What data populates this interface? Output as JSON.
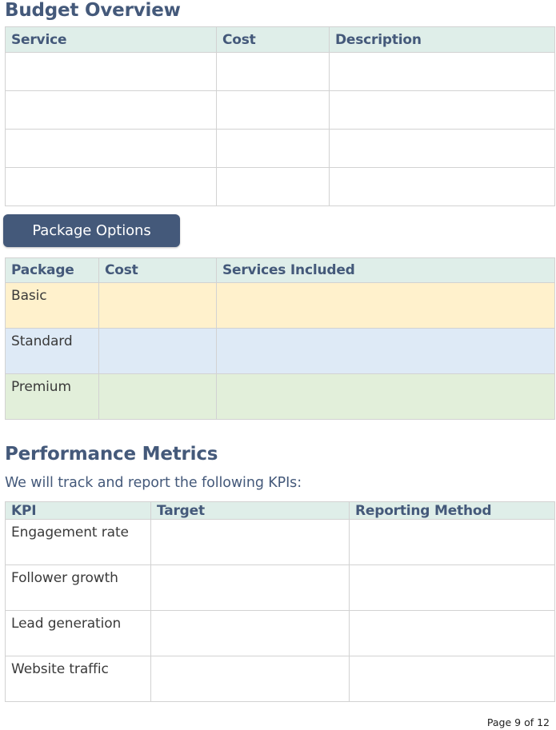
{
  "budget_overview": {
    "title": "Budget Overview",
    "columns": [
      "Service",
      "Cost",
      "Description"
    ],
    "rows": [
      [
        "",
        "",
        ""
      ],
      [
        "",
        "",
        ""
      ],
      [
        "",
        "",
        ""
      ],
      [
        "",
        "",
        ""
      ]
    ]
  },
  "package_options": {
    "button_label": "Package Options",
    "button_color": "#44597a",
    "columns": [
      "Package",
      "Cost",
      "Services Included"
    ],
    "rows": [
      {
        "name": "Basic",
        "cost": "",
        "services": "",
        "color": "#fff1cc"
      },
      {
        "name": "Standard",
        "cost": "",
        "services": "",
        "color": "#deeaf6"
      },
      {
        "name": "Premium",
        "cost": "",
        "services": "",
        "color": "#e2efda"
      }
    ]
  },
  "performance_metrics": {
    "title": "Performance Metrics",
    "intro": "We will track and report the following KPIs:",
    "columns": [
      "KPI",
      "Target",
      "Reporting Method"
    ],
    "rows": [
      {
        "kpi": "Engagement rate",
        "target": "",
        "method": ""
      },
      {
        "kpi": "Follower growth",
        "target": "",
        "method": ""
      },
      {
        "kpi": "Lead generation",
        "target": "",
        "method": ""
      },
      {
        "kpi": "Website traffic",
        "target": "",
        "method": ""
      }
    ]
  },
  "colors": {
    "heading": "#44597a",
    "header_fill": "#dfeee9",
    "border": "#d2d2d2"
  },
  "footer": {
    "page_label": "Page 9 of 12"
  }
}
